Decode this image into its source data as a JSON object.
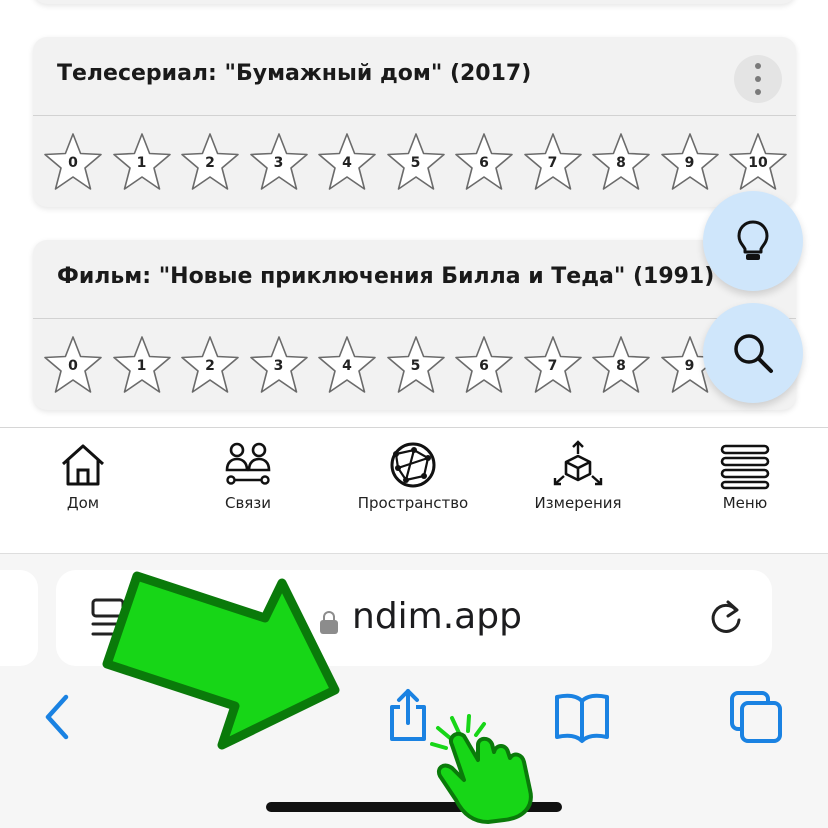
{
  "cards": [
    {
      "title": "Телесериал: \"Бумажный дом\" (2017)",
      "stars": [
        "0",
        "1",
        "2",
        "3",
        "4",
        "5",
        "6",
        "7",
        "8",
        "9",
        "10"
      ]
    },
    {
      "title": "Фильм: \"Новые приключения Билла и Теда\" (1991)",
      "stars": [
        "0",
        "1",
        "2",
        "3",
        "4",
        "5",
        "6",
        "7",
        "8",
        "9"
      ]
    }
  ],
  "fabs": [
    {
      "icon": "lightbulb-icon"
    },
    {
      "icon": "search-icon"
    }
  ],
  "nav": {
    "items": [
      {
        "label": "Дом",
        "icon": "home-icon"
      },
      {
        "label": "Связи",
        "icon": "connections-icon"
      },
      {
        "label": "Пространство",
        "icon": "globe-network-icon"
      },
      {
        "label": "Измерения",
        "icon": "cube-dimensions-icon"
      },
      {
        "label": "Меню",
        "icon": "menu-icon"
      }
    ]
  },
  "browser": {
    "url": "ndim.app",
    "toolbar": [
      "back-icon",
      "share-icon",
      "bookmarks-icon",
      "tabs-icon"
    ]
  },
  "colors": {
    "accent": "#1a82e2",
    "fab_bg": "#cfe6fb",
    "arrow_green": "#17d617",
    "arrow_outline": "#0a7a0a"
  }
}
